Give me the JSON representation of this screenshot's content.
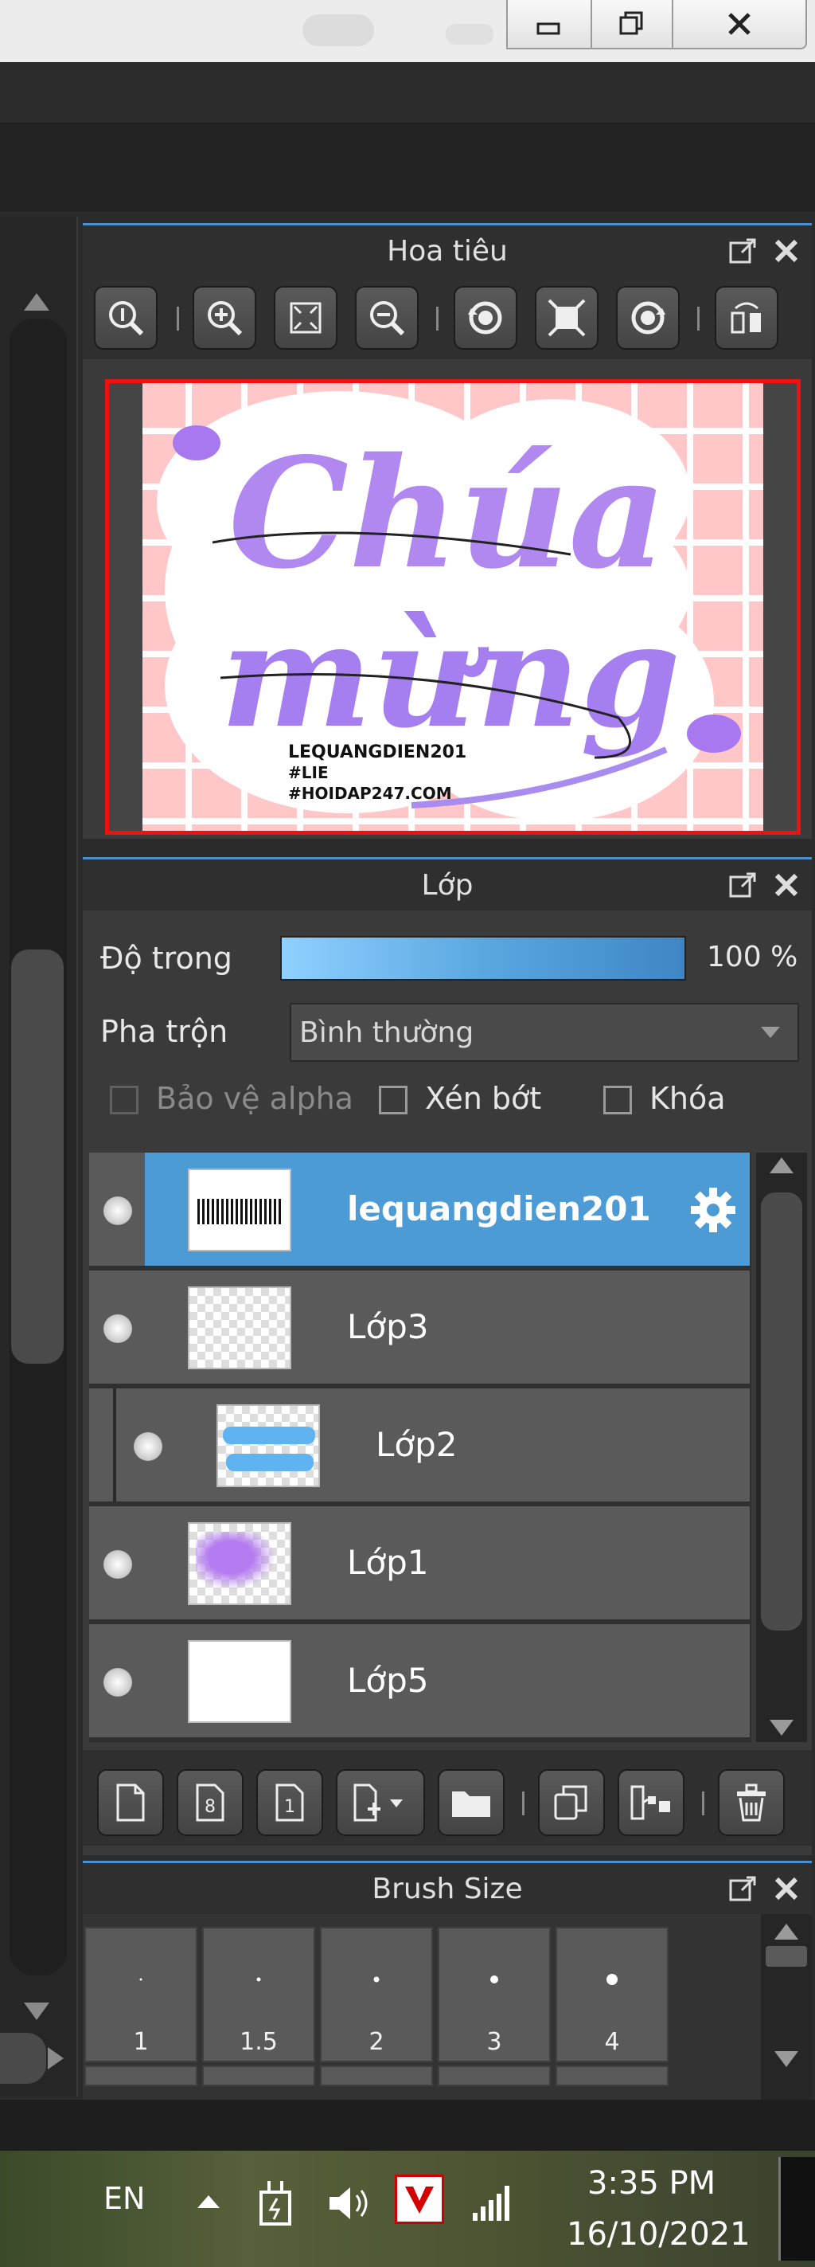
{
  "window": {
    "buttons": [
      {
        "name": "minimize",
        "icon": "minimize-icon"
      },
      {
        "name": "restore",
        "icon": "restore-icon"
      },
      {
        "name": "close",
        "icon": "close-icon"
      }
    ]
  },
  "navigator": {
    "title": "Hoa tiêu",
    "tools": [
      "zoom-actual-icon",
      "zoom-in-icon",
      "fit-screen-icon",
      "zoom-out-icon",
      "rotate-left-icon",
      "reset-view-icon",
      "rotate-right-icon",
      "flip-icon"
    ],
    "preview": {
      "line1": "Chúa",
      "line2": "mừng",
      "signature": [
        "LEQUANGDIEN201",
        "#LIE",
        "#HOIDAP247.COM"
      ]
    }
  },
  "layers": {
    "title": "Lớp",
    "opacity_label": "Độ trong",
    "opacity_value": "100 %",
    "opacity_fraction": 1.0,
    "blend_label": "Pha trộn",
    "blend_value": "Bình thường",
    "checkboxes": {
      "protect_alpha": "Bảo vệ alpha",
      "clipping": "Xén bớt",
      "lock": "Khóa"
    },
    "items": [
      {
        "name": "lequangdien201",
        "selected": true
      },
      {
        "name": "Lớp3",
        "selected": false
      },
      {
        "name": "Lớp2",
        "selected": false,
        "clipped": true
      },
      {
        "name": "Lớp1",
        "selected": false
      },
      {
        "name": "Lớp5",
        "selected": false
      }
    ],
    "actions": [
      "new-layer-icon",
      "new-8bit-layer-icon",
      "new-1bit-layer-icon",
      "add-layer-menu-icon",
      "new-folder-icon",
      "duplicate-icon",
      "merge-down-icon",
      "delete-icon"
    ]
  },
  "brush_size": {
    "title": "Brush Size",
    "sizes": [
      "1",
      "1.5",
      "2",
      "3",
      "4"
    ]
  },
  "taskbar": {
    "language": "EN",
    "time": "3:35 PM",
    "date": "16/10/2021",
    "icons": [
      "show-hidden-icon",
      "power-plug-icon",
      "volume-icon",
      "antivirus-v-icon",
      "signal-icon"
    ]
  },
  "colors": {
    "accent": "#4d9bd5",
    "selection_border": "#e11111",
    "preview_bg": "#ffc7c7"
  }
}
